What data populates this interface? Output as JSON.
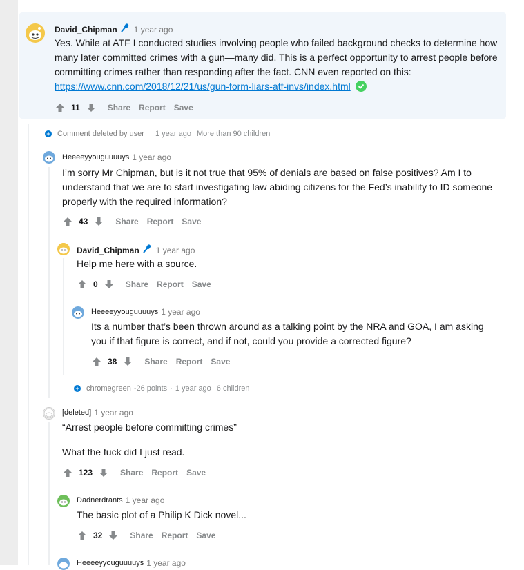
{
  "comments": {
    "c1": {
      "author": "David_Chipman",
      "time": "1 year ago",
      "body_text": "Yes. While at ATF I conducted studies involving people who failed background checks to determine how many later committed crimes with a gun—many did. This is a perfect opportunity to arrest people before committing crimes rather than responding after the fact. CNN even reported on this: ",
      "link": "https://www.cnn.com/2018/12/21/us/gun-form-liars-atf-invs/index.html",
      "score": "11",
      "share": "Share",
      "report": "Report",
      "save": "Save"
    },
    "deleted_row": {
      "author": "Comment deleted by user",
      "time": "1 year ago",
      "extra": "More than 90 children"
    },
    "c2": {
      "author": "Heeeeyyouguuuuys",
      "time": "1 year ago",
      "body_text": "I’m sorry Mr Chipman, but is it not true that 95% of denials are based on false positives? Am I to understand that we are to start investigating law abiding citizens for the Fed’s inability to ID someone properly with the required information?",
      "score": "43",
      "share": "Share",
      "report": "Report",
      "save": "Save"
    },
    "c3": {
      "author": "David_Chipman",
      "time": "1 year ago",
      "body_text": "Help me here with a source.",
      "score": "0",
      "share": "Share",
      "report": "Report",
      "save": "Save"
    },
    "c4": {
      "author": "Heeeeyyouguuuuys",
      "time": "1 year ago",
      "body_text": "Its a number that’s been thrown around as a talking point by the NRA and GOA, I am asking you if that figure is correct, and if not, could you provide a corrected figure?",
      "score": "38",
      "share": "Share",
      "report": "Report",
      "save": "Save"
    },
    "collapsed_row": {
      "author": "chromegreen",
      "points": "-26 points",
      "dot": "·",
      "time": "1 year ago",
      "extra": "6 children"
    },
    "c5": {
      "author": "[deleted]",
      "time": "1 year ago",
      "body_line1": "“Arrest people before committing crimes”",
      "body_line2": "What the fuck did I just read.",
      "score": "123",
      "share": "Share",
      "report": "Report",
      "save": "Save"
    },
    "c6": {
      "author": "Dadnerdrants",
      "time": "1 year ago",
      "body_text": "The basic plot of a Philip K Dick novel...",
      "score": "32",
      "share": "Share",
      "report": "Report",
      "save": "Save"
    },
    "c7": {
      "author": "Heeeeyyouguuuuys",
      "time": "1 year ago"
    }
  },
  "colors": {
    "link": "#0079d3",
    "highlight_bg": "#f1f6fb",
    "verified": "#46d160",
    "meta": "#7c7c7c"
  },
  "icons": {
    "mod_badge": "microphone-icon",
    "verified": "check-circle-icon",
    "upvote": "arrow-up-icon",
    "downvote": "arrow-down-icon",
    "expand": "plus-circle-icon"
  }
}
